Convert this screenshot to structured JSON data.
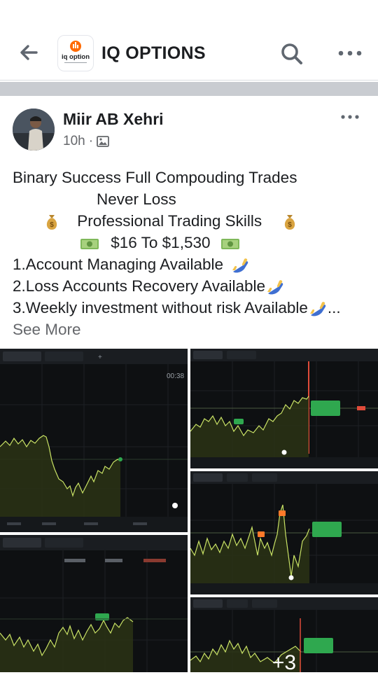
{
  "header": {
    "title": "IQ OPTIONS",
    "logo_text": "iq option",
    "back_icon": "arrow-left-icon",
    "search_icon": "search-icon",
    "more_icon": "more-horizontal-icon"
  },
  "post": {
    "author": "Miir AB Xehri",
    "time": "10h",
    "separator": "·",
    "privacy_icon": "photo-icon",
    "more_icon": "more-horizontal-icon",
    "lines": {
      "l1": "Binary Success Full Compouding Trades",
      "l2": "Never Loss",
      "l3": "Professional Trading Skills",
      "l4": "$16 To $1,530",
      "l5": "1.Account Managing Available",
      "l6": "2.Loss Accounts Recovery Available",
      "l7": "3.Weekly investment without risk Available",
      "l7_ellipsis": "..."
    },
    "see_more": "See More",
    "emojis": [
      "money-bag-icon",
      "banknote-icon",
      "call-me-hand-icon"
    ]
  },
  "photos": {
    "more_count": "+3",
    "ph1_timer": "00:38"
  },
  "colors": {
    "brand_orange": "#ff6a00",
    "divider": "#c9ccd1",
    "chart_line": "#c9e265",
    "chart_bg": "#0e1012",
    "buy_green": "#2fa84f"
  }
}
